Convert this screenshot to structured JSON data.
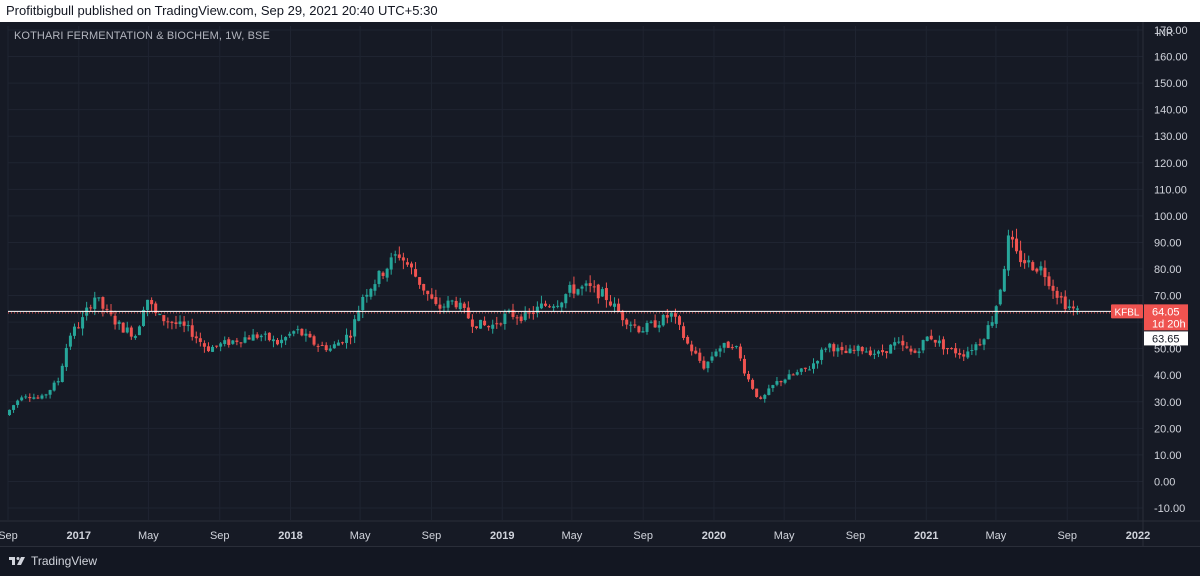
{
  "header": {
    "publish_text": "Profitbigbull published on TradingView.com, Sep 29, 2021 20:40 UTC+5:30"
  },
  "chart_title": "KOTHARI FERMENTATION & BIOCHEM, 1W, BSE",
  "currency_label": "INR",
  "footer": {
    "brand_name": "TradingView"
  },
  "colors": {
    "background": "#161a25",
    "up": "#26a69a",
    "down": "#ef5350",
    "grid": "#1f2431",
    "price_line": "#ffffff",
    "axis_text": "#d1d4dc"
  },
  "chart_data": {
    "type": "candlestick",
    "title": "KOTHARI FERMENTATION & BIOCHEM, 1W, BSE",
    "ylabel": "INR",
    "ylim": [
      -15,
      170
    ],
    "y_ticks": [
      -10,
      0,
      10,
      20,
      30,
      40,
      50,
      60,
      70,
      80,
      90,
      100,
      110,
      120,
      130,
      140,
      150,
      160,
      170
    ],
    "x_ticks": [
      {
        "label": "Sep",
        "date": "2016-09-01",
        "bold": false
      },
      {
        "label": "2017",
        "date": "2017-01-01",
        "bold": true
      },
      {
        "label": "May",
        "date": "2017-05-01",
        "bold": false
      },
      {
        "label": "Sep",
        "date": "2017-09-01",
        "bold": false
      },
      {
        "label": "2018",
        "date": "2018-01-01",
        "bold": true
      },
      {
        "label": "May",
        "date": "2018-05-01",
        "bold": false
      },
      {
        "label": "Sep",
        "date": "2018-09-01",
        "bold": false
      },
      {
        "label": "2019",
        "date": "2019-01-01",
        "bold": true
      },
      {
        "label": "May",
        "date": "2019-05-01",
        "bold": false
      },
      {
        "label": "Sep",
        "date": "2019-09-01",
        "bold": false
      },
      {
        "label": "2020",
        "date": "2020-01-01",
        "bold": true
      },
      {
        "label": "May",
        "date": "2020-05-01",
        "bold": false
      },
      {
        "label": "Sep",
        "date": "2020-09-01",
        "bold": false
      },
      {
        "label": "2021",
        "date": "2021-01-01",
        "bold": true
      },
      {
        "label": "May",
        "date": "2021-05-01",
        "bold": false
      },
      {
        "label": "Sep",
        "date": "2021-09-01",
        "bold": false
      },
      {
        "label": "2022",
        "date": "2022-01-01",
        "bold": true
      }
    ],
    "x_range": [
      "2016-09-01",
      "2022-01-01"
    ],
    "weekly_close_path": [
      {
        "date": "2016-09-01",
        "close": 25
      },
      {
        "date": "2016-10-01",
        "close": 33
      },
      {
        "date": "2016-11-01",
        "close": 31
      },
      {
        "date": "2016-12-01",
        "close": 38
      },
      {
        "date": "2016-12-20",
        "close": 55
      },
      {
        "date": "2017-01-10",
        "close": 60
      },
      {
        "date": "2017-02-01",
        "close": 70
      },
      {
        "date": "2017-02-20",
        "close": 64
      },
      {
        "date": "2017-03-20",
        "close": 58
      },
      {
        "date": "2017-04-15",
        "close": 55
      },
      {
        "date": "2017-05-01",
        "close": 70
      },
      {
        "date": "2017-05-20",
        "close": 62
      },
      {
        "date": "2017-06-15",
        "close": 60
      },
      {
        "date": "2017-07-15",
        "close": 57
      },
      {
        "date": "2017-08-15",
        "close": 50
      },
      {
        "date": "2017-09-15",
        "close": 52
      },
      {
        "date": "2017-10-15",
        "close": 54
      },
      {
        "date": "2017-11-15",
        "close": 55
      },
      {
        "date": "2017-12-15",
        "close": 52
      },
      {
        "date": "2018-01-15",
        "close": 57
      },
      {
        "date": "2018-02-15",
        "close": 52
      },
      {
        "date": "2018-03-15",
        "close": 50
      },
      {
        "date": "2018-04-20",
        "close": 56
      },
      {
        "date": "2018-05-10",
        "close": 70
      },
      {
        "date": "2018-06-10",
        "close": 78
      },
      {
        "date": "2018-07-10",
        "close": 86
      },
      {
        "date": "2018-08-01",
        "close": 80
      },
      {
        "date": "2018-08-25",
        "close": 72
      },
      {
        "date": "2018-09-15",
        "close": 65
      },
      {
        "date": "2018-10-15",
        "close": 68
      },
      {
        "date": "2018-11-15",
        "close": 60
      },
      {
        "date": "2018-12-15",
        "close": 58
      },
      {
        "date": "2019-01-15",
        "close": 63
      },
      {
        "date": "2019-02-15",
        "close": 62
      },
      {
        "date": "2019-03-15",
        "close": 66
      },
      {
        "date": "2019-04-15",
        "close": 68
      },
      {
        "date": "2019-05-01",
        "close": 72
      },
      {
        "date": "2019-06-01",
        "close": 73
      },
      {
        "date": "2019-07-01",
        "close": 70
      },
      {
        "date": "2019-08-01",
        "close": 62
      },
      {
        "date": "2019-09-01",
        "close": 57
      },
      {
        "date": "2019-10-01",
        "close": 60
      },
      {
        "date": "2019-10-25",
        "close": 63
      },
      {
        "date": "2019-11-20",
        "close": 52
      },
      {
        "date": "2019-12-20",
        "close": 43
      },
      {
        "date": "2020-01-10",
        "close": 50
      },
      {
        "date": "2020-02-10",
        "close": 52
      },
      {
        "date": "2020-03-01",
        "close": 40
      },
      {
        "date": "2020-03-25",
        "close": 30
      },
      {
        "date": "2020-04-20",
        "close": 37
      },
      {
        "date": "2020-05-20",
        "close": 40
      },
      {
        "date": "2020-06-20",
        "close": 43
      },
      {
        "date": "2020-07-20",
        "close": 52
      },
      {
        "date": "2020-08-15",
        "close": 48
      },
      {
        "date": "2020-09-15",
        "close": 50
      },
      {
        "date": "2020-10-15",
        "close": 48
      },
      {
        "date": "2020-11-15",
        "close": 52
      },
      {
        "date": "2020-12-15",
        "close": 48
      },
      {
        "date": "2021-01-10",
        "close": 55
      },
      {
        "date": "2021-02-10",
        "close": 50
      },
      {
        "date": "2021-03-10",
        "close": 48
      },
      {
        "date": "2021-04-10",
        "close": 53
      },
      {
        "date": "2021-05-01",
        "close": 62
      },
      {
        "date": "2021-05-15",
        "close": 75
      },
      {
        "date": "2021-05-28",
        "close": 92
      },
      {
        "date": "2021-06-10",
        "close": 85
      },
      {
        "date": "2021-07-01",
        "close": 82
      },
      {
        "date": "2021-07-25",
        "close": 80
      },
      {
        "date": "2021-08-15",
        "close": 72
      },
      {
        "date": "2021-09-01",
        "close": 67
      },
      {
        "date": "2021-09-20",
        "close": 64
      }
    ],
    "current_price": {
      "symbol": "KFBL",
      "value": 64.05,
      "value_label": "64.05",
      "countdown": "1d 20h"
    },
    "crosshair_price": {
      "value": 63.65,
      "value_label": "63.65"
    }
  }
}
